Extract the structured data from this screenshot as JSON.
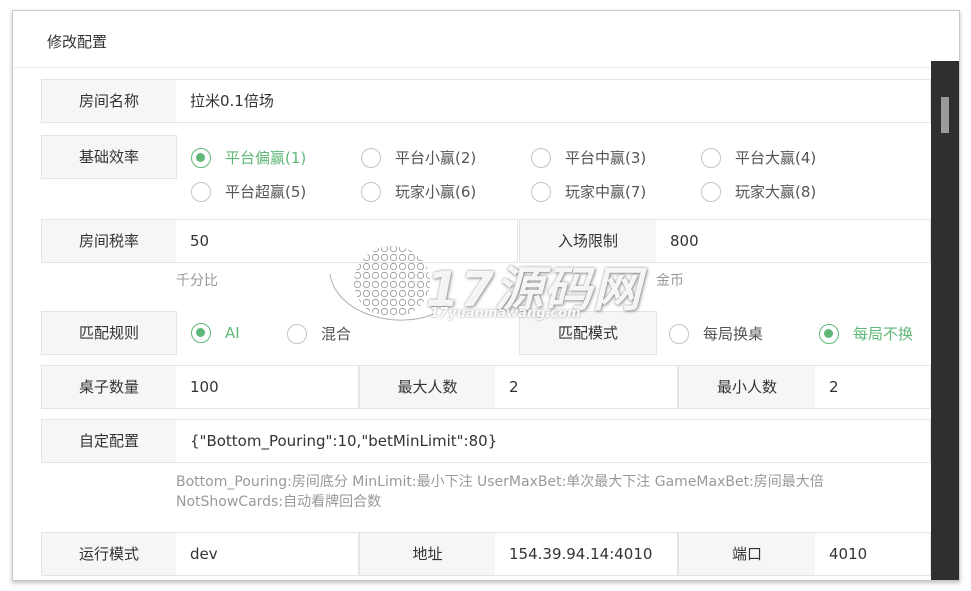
{
  "dialog": {
    "title": "修改配置"
  },
  "room_name": {
    "label": "房间名称",
    "value": "拉米0.1倍场"
  },
  "base_rate": {
    "label": "基础效率",
    "options": [
      {
        "label": "平台偏赢(1)",
        "checked": true
      },
      {
        "label": "平台小赢(2)",
        "checked": false
      },
      {
        "label": "平台中赢(3)",
        "checked": false
      },
      {
        "label": "平台大赢(4)",
        "checked": false
      },
      {
        "label": "平台超赢(5)",
        "checked": false
      },
      {
        "label": "玩家小赢(6)",
        "checked": false
      },
      {
        "label": "玩家中赢(7)",
        "checked": false
      },
      {
        "label": "玩家大赢(8)",
        "checked": false
      }
    ]
  },
  "room_tax": {
    "label": "房间税率",
    "value": "50",
    "hint": "千分比"
  },
  "entry_limit": {
    "label": "入场限制",
    "value": "800",
    "hint": "金币"
  },
  "match_rule": {
    "label": "匹配规则",
    "options": [
      {
        "label": "AI",
        "checked": true
      },
      {
        "label": "混合",
        "checked": false
      }
    ]
  },
  "match_mode": {
    "label": "匹配模式",
    "options": [
      {
        "label": "每局换桌",
        "checked": false
      },
      {
        "label": "每局不换",
        "checked": true
      }
    ]
  },
  "table_count": {
    "label": "桌子数量",
    "value": "100"
  },
  "max_players": {
    "label": "最大人数",
    "value": "2"
  },
  "min_players": {
    "label": "最小人数",
    "value": "2"
  },
  "custom_config": {
    "label": "自定配置",
    "value": "{\"Bottom_Pouring\":10,\"betMinLimit\":80}",
    "hint_line1": "Bottom_Pouring:房间底分 MinLimit:最小下注 UserMaxBet:单次最大下注 GameMaxBet:房间最大倍",
    "hint_line2": "NotShowCards:自动看牌回合数"
  },
  "run_mode": {
    "label": "运行模式",
    "value": "dev"
  },
  "address": {
    "label": "地址",
    "value": "154.39.94.14:4010"
  },
  "port": {
    "label": "端口",
    "value": "4010"
  },
  "watermark": {
    "text": "17源码网",
    "sub": "17yuanmawang.com"
  },
  "colors": {
    "accent": "#5fb878",
    "label_bg": "#f6f6f6",
    "border": "#e4e4e4",
    "hint": "#999999"
  }
}
